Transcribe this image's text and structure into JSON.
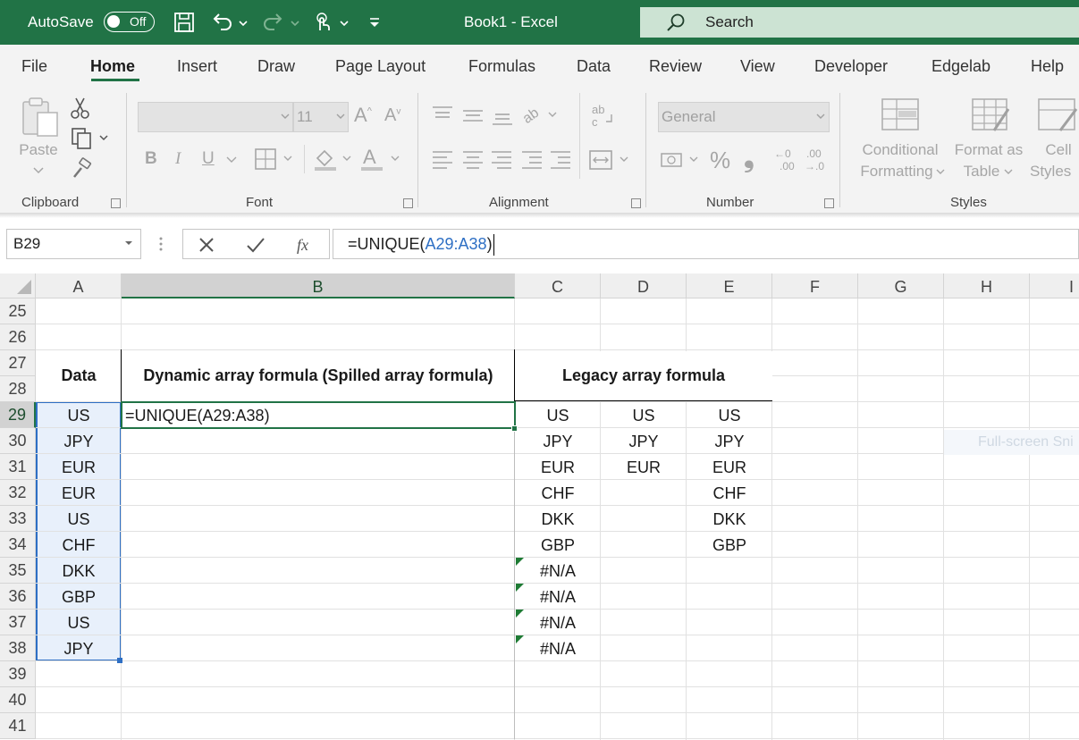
{
  "titlebar": {
    "autosave_label": "AutoSave",
    "autosave_state": "Off",
    "title": "Book1  -  Excel",
    "search_placeholder": "Search"
  },
  "tabs": [
    "File",
    "Home",
    "Insert",
    "Draw",
    "Page Layout",
    "Formulas",
    "Data",
    "Review",
    "View",
    "Developer",
    "Edgelab",
    "Help"
  ],
  "active_tab": "Home",
  "ribbon": {
    "clipboard": {
      "label": "Clipboard",
      "paste": "Paste"
    },
    "font": {
      "label": "Font",
      "font_size": "11",
      "bold": "B",
      "italic": "I",
      "underline": "U"
    },
    "alignment": {
      "label": "Alignment"
    },
    "number": {
      "label": "Number",
      "format": "General",
      "percent": "%",
      "comma": "❟"
    },
    "styles": {
      "label": "Styles",
      "conditional_1": "Conditional",
      "conditional_2": "Formatting",
      "format_table_1": "Format as",
      "format_table_2": "Table",
      "cell_styles_1": "Cell",
      "cell_styles_2": "Styles"
    }
  },
  "formula_bar": {
    "name_box": "B29",
    "formula_prefix": "=UNIQUE(",
    "formula_ref": "A29:A38",
    "formula_suffix": ")"
  },
  "sheet": {
    "columns": [
      "A",
      "B",
      "C",
      "D",
      "E",
      "F",
      "G",
      "H",
      "I"
    ],
    "selected_column": "B",
    "rows": [
      "25",
      "26",
      "27",
      "28",
      "29",
      "30",
      "31",
      "32",
      "33",
      "34",
      "35",
      "36",
      "37",
      "38",
      "39",
      "40",
      "41"
    ],
    "selected_row": "29",
    "header_data": "Data",
    "header_dynamic": "Dynamic array formula (Spilled array formula)",
    "header_legacy": "Legacy array formula",
    "active_cell_text": "=UNIQUE(A29:A38)",
    "col_a": [
      "US",
      "JPY",
      "EUR",
      "EUR",
      "US",
      "CHF",
      "DKK",
      "GBP",
      "US",
      "JPY"
    ],
    "col_c": [
      "US",
      "JPY",
      "EUR",
      "CHF",
      "DKK",
      "GBP",
      "#N/A",
      "#N/A",
      "#N/A",
      "#N/A"
    ],
    "col_d": [
      "US",
      "JPY",
      "EUR"
    ],
    "col_e": [
      "US",
      "JPY",
      "EUR",
      "CHF",
      "DKK",
      "GBP"
    ],
    "overlay_text": "Full-screen Sni"
  },
  "colors": {
    "accent": "#217346",
    "search_bg": "#cce3d3",
    "selection_fill": "#e8f0fb",
    "selection_border": "#2e6fc4",
    "error_indicator": "#1e7b34"
  }
}
